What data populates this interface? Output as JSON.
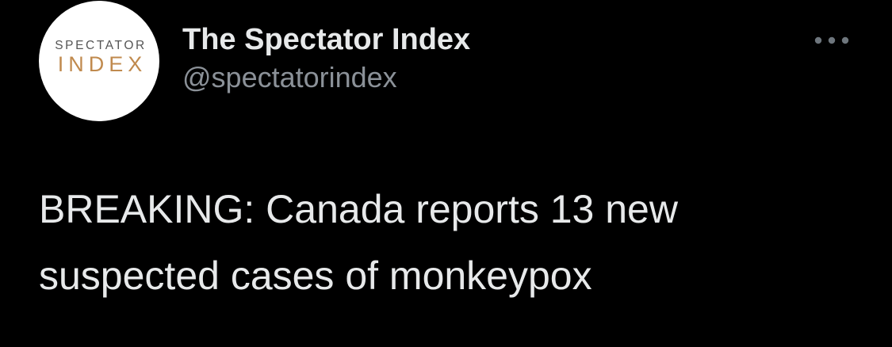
{
  "author": {
    "display_name": "The Spectator Index",
    "handle": "@spectatorindex",
    "avatar": {
      "logo_line1": "SPECTATOR",
      "logo_line2": "INDEX",
      "logo_line1_color": "#555555",
      "logo_line2_color": "#c08a4e",
      "background": "#ffffff"
    }
  },
  "menu": {
    "icon": "more-horizontal-icon"
  },
  "tweet": {
    "text": "BREAKING: Canada reports 13 new suspected cases of monkeypox"
  },
  "theme": {
    "background": "#000000",
    "primary_text": "#e7e9ea",
    "secondary_text": "#8b9198"
  }
}
